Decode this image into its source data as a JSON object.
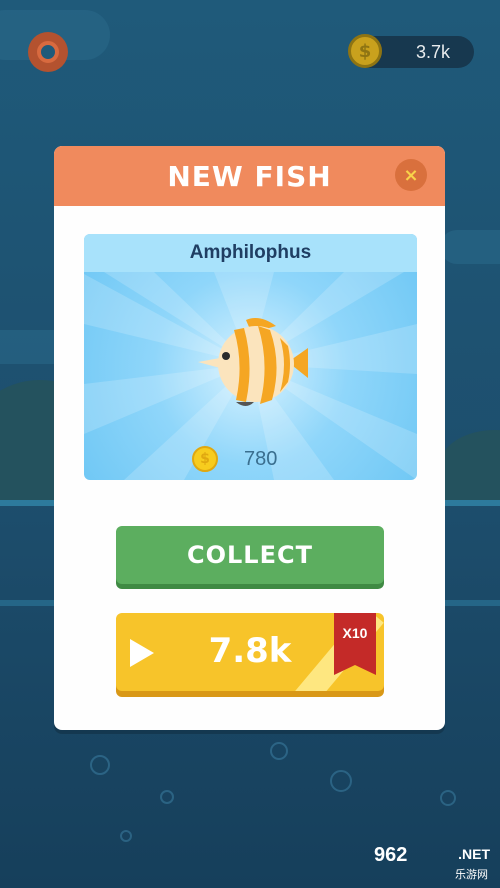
{
  "colors": {
    "header": "#f08a5d",
    "collect": "#5cae5f",
    "ad_button": "#f7c42a",
    "badge": "#c42a28"
  },
  "top_bar": {
    "settings_icon": "gear-icon",
    "coin_icon": "coin-icon",
    "balance": "3.7k"
  },
  "modal": {
    "title": "NEW FISH",
    "close_label": "×",
    "fish": {
      "name": "Amphilophus",
      "reward": "780"
    },
    "collect_label": "COLLECT",
    "ad": {
      "value": "7.8k",
      "multiplier": "X10",
      "play_icon": "play-icon"
    }
  },
  "watermark": {
    "brand": "962",
    "suffix": ".NET",
    "sub": "乐游网"
  }
}
